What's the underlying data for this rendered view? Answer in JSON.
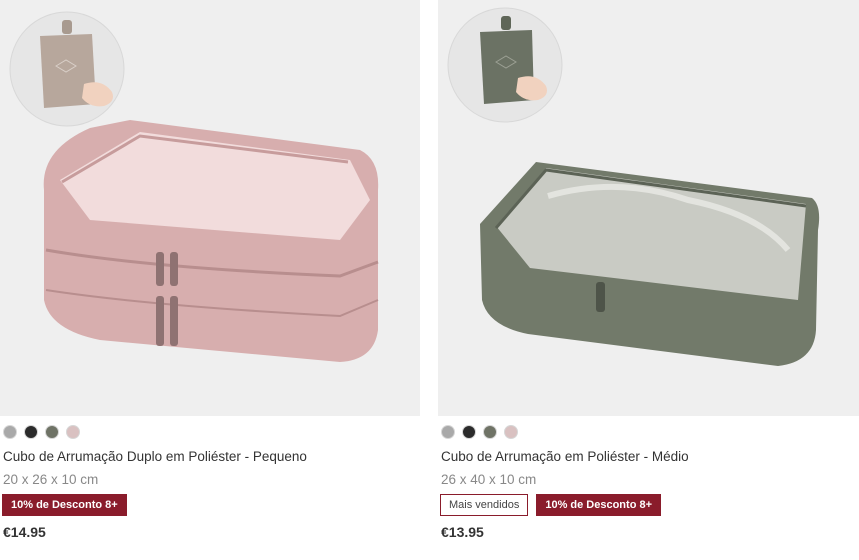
{
  "products": [
    {
      "colors": [
        "#a9a9a9",
        "#2b2b2b",
        "#6f7366",
        "#d9c1c1"
      ],
      "color_names": [
        "grey-swatch",
        "black-swatch",
        "khaki-swatch",
        "pink-swatch"
      ],
      "title": "Cubo de Arrumação Duplo em Poliéster - Pequeno",
      "dims": "20 x 26 x 10 cm",
      "badges": [],
      "discount": "10% de Desconto 8+",
      "price": "€14.95"
    },
    {
      "colors": [
        "#a9a9a9",
        "#2b2b2b",
        "#6f7366",
        "#d9c1c1"
      ],
      "color_names": [
        "grey-swatch",
        "black-swatch",
        "khaki-swatch",
        "pink-swatch"
      ],
      "title": "Cubo de Arrumação em Poliéster - Médio",
      "dims": "26 x 40 x 10 cm",
      "badges": [
        "Mais vendidos"
      ],
      "discount": "10% de Desconto 8+",
      "price": "€13.95"
    }
  ]
}
